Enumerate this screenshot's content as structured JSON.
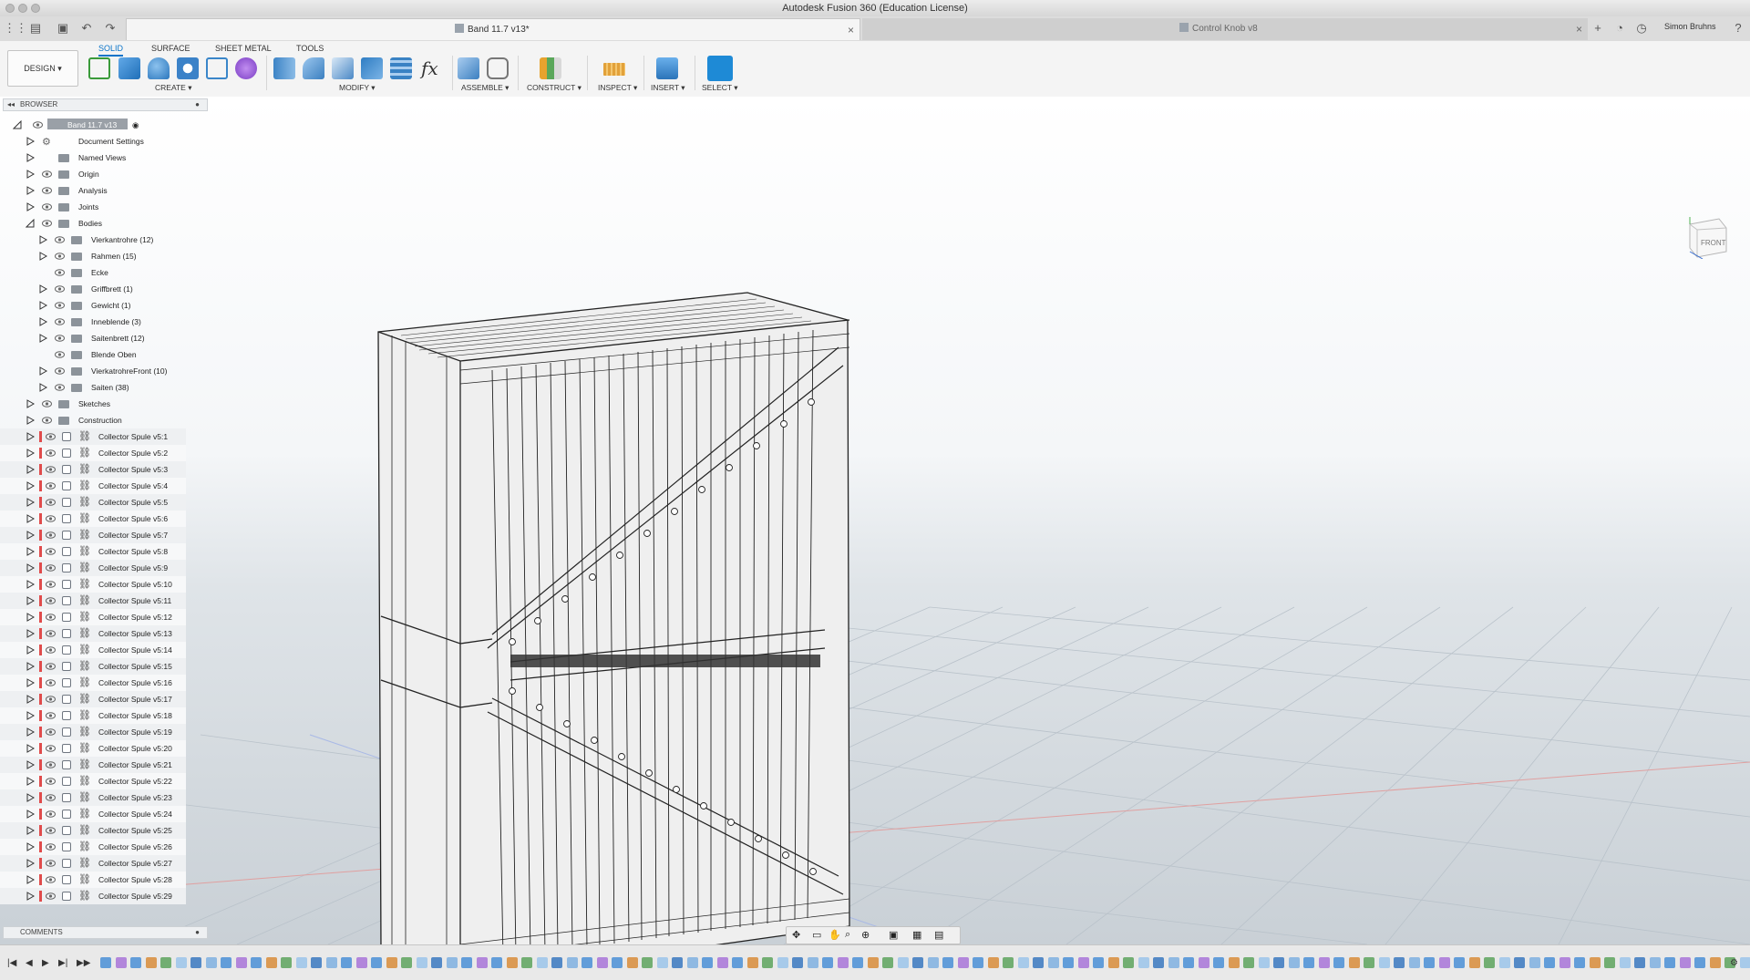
{
  "window": {
    "title": "Autodesk Fusion 360 (Education License)"
  },
  "tabs": [
    {
      "label": "Band 11.7 v13*",
      "active": true
    },
    {
      "label": "Control Knob v8",
      "active": false
    }
  ],
  "user": {
    "name": "Simon Bruhns"
  },
  "ribbon": {
    "workspace": "DESIGN ▾",
    "tabs": [
      "SOLID",
      "SURFACE",
      "SHEET METAL",
      "TOOLS"
    ],
    "groups": {
      "create": "CREATE ▾",
      "modify": "MODIFY ▾",
      "assemble": "ASSEMBLE ▾",
      "construct": "CONSTRUCT ▾",
      "inspect": "INSPECT ▾",
      "insert": "INSERT ▾",
      "select": "SELECT ▾"
    },
    "fx_label": "fx"
  },
  "browser": {
    "title": "BROWSER",
    "root": "Band 11.7 v13",
    "items": [
      {
        "label": "Document Settings",
        "level": 1
      },
      {
        "label": "Named Views",
        "level": 1
      },
      {
        "label": "Origin",
        "level": 1
      },
      {
        "label": "Analysis",
        "level": 1
      },
      {
        "label": "Joints",
        "level": 1
      },
      {
        "label": "Bodies",
        "level": 1
      },
      {
        "label": "Vierkantrohre (12)",
        "level": 2
      },
      {
        "label": "Rahmen (15)",
        "level": 2
      },
      {
        "label": "Ecke",
        "level": 2
      },
      {
        "label": "Griffbrett (1)",
        "level": 2
      },
      {
        "label": "Gewicht (1)",
        "level": 2
      },
      {
        "label": "Inneblende (3)",
        "level": 2
      },
      {
        "label": "Saitenbrett (12)",
        "level": 2
      },
      {
        "label": "Blende Oben",
        "level": 2
      },
      {
        "label": "VierkatrohreFront (10)",
        "level": 2
      },
      {
        "label": "Saiten (38)",
        "level": 2
      },
      {
        "label": "Sketches",
        "level": 1
      },
      {
        "label": "Construction",
        "level": 1
      }
    ],
    "components": [
      "Collector Spule v5:1",
      "Collector Spule v5:2",
      "Collector Spule v5:3",
      "Collector Spule v5:4",
      "Collector Spule v5:5",
      "Collector Spule v5:6",
      "Collector Spule v5:7",
      "Collector Spule v5:8",
      "Collector Spule v5:9",
      "Collector Spule v5:10",
      "Collector Spule v5:11",
      "Collector Spule v5:12",
      "Collector Spule v5:13",
      "Collector Spule v5:14",
      "Collector Spule v5:15",
      "Collector Spule v5:16",
      "Collector Spule v5:17",
      "Collector Spule v5:18",
      "Collector Spule v5:19",
      "Collector Spule v5:20",
      "Collector Spule v5:21",
      "Collector Spule v5:22",
      "Collector Spule v5:23",
      "Collector Spule v5:24",
      "Collector Spule v5:25",
      "Collector Spule v5:26",
      "Collector Spule v5:27",
      "Collector Spule v5:28",
      "Collector Spule v5:29"
    ]
  },
  "comments": {
    "title": "COMMENTS"
  },
  "viewcube": {
    "face": "FRONT"
  },
  "colors": {
    "accent": "#0a74c9",
    "component_flag": "#e04b4b",
    "timeline_feature": "#4a8fd6"
  }
}
